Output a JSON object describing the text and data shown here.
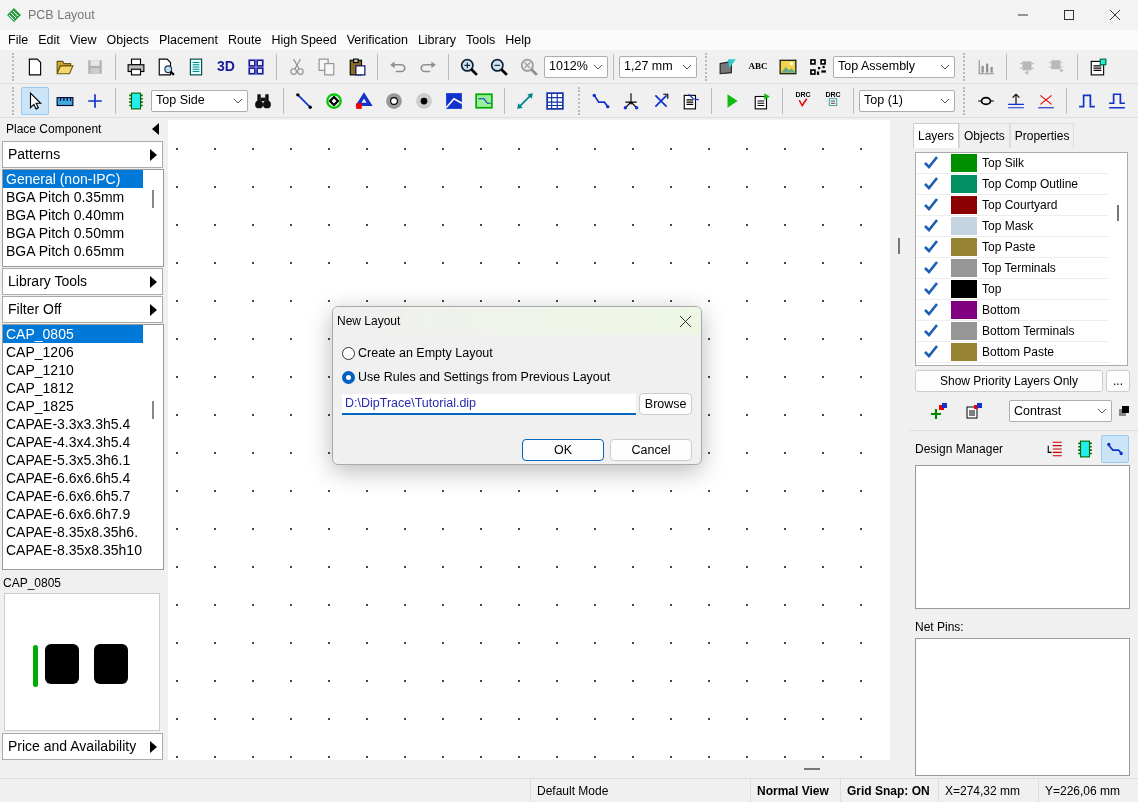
{
  "window": {
    "title": "PCB Layout"
  },
  "menu": [
    "File",
    "Edit",
    "View",
    "Objects",
    "Placement",
    "Route",
    "High Speed",
    "Verification",
    "Library",
    "Tools",
    "Help"
  ],
  "toolbars": [
    [
      {
        "kind": "grip"
      },
      {
        "kind": "button",
        "disabled": false,
        "pressed": false
      },
      {
        "kind": "button",
        "disabled": false,
        "pressed": false
      },
      {
        "kind": "button",
        "disabled": true,
        "pressed": false
      },
      {
        "kind": "sep"
      },
      {
        "kind": "button",
        "disabled": false,
        "pressed": false
      },
      {
        "kind": "button",
        "disabled": false,
        "pressed": false
      },
      {
        "kind": "button",
        "disabled": false,
        "pressed": false
      },
      {
        "kind": "label-button",
        "label": "3D",
        "disabled": false,
        "pressed": false
      },
      {
        "kind": "button",
        "disabled": false,
        "pressed": false
      },
      {
        "kind": "sep"
      },
      {
        "kind": "button",
        "disabled": true,
        "pressed": false
      },
      {
        "kind": "button",
        "disabled": true,
        "pressed": false
      },
      {
        "kind": "button",
        "disabled": false,
        "pressed": false
      },
      {
        "kind": "sep"
      },
      {
        "kind": "button",
        "disabled": true,
        "pressed": false
      },
      {
        "kind": "button",
        "disabled": true,
        "pressed": false
      },
      {
        "kind": "sep"
      },
      {
        "kind": "button",
        "disabled": false,
        "pressed": false
      },
      {
        "kind": "button",
        "disabled": false,
        "pressed": false
      },
      {
        "kind": "button",
        "disabled": true,
        "pressed": false
      },
      {
        "kind": "combo",
        "value": "1012%"
      },
      {
        "kind": "sep"
      },
      {
        "kind": "combo",
        "value": "1,27 mm"
      },
      {
        "kind": "grip"
      },
      {
        "kind": "button",
        "disabled": false,
        "pressed": false
      },
      {
        "kind": "label-button",
        "label": "ABC",
        "disabled": false,
        "pressed": false
      },
      {
        "kind": "button",
        "disabled": false,
        "pressed": false
      },
      {
        "kind": "button",
        "disabled": false,
        "pressed": false
      },
      {
        "kind": "combo",
        "value": "Top Assembly"
      },
      {
        "kind": "grip"
      },
      {
        "kind": "button",
        "disabled": true,
        "pressed": false
      },
      {
        "kind": "sep"
      },
      {
        "kind": "button",
        "disabled": true,
        "pressed": false
      },
      {
        "kind": "button",
        "disabled": true,
        "pressed": false
      },
      {
        "kind": "sep"
      },
      {
        "kind": "button",
        "disabled": false,
        "pressed": false
      }
    ],
    [
      {
        "kind": "grip"
      },
      {
        "kind": "button",
        "disabled": false,
        "pressed": true
      },
      {
        "kind": "button",
        "disabled": false,
        "pressed": false
      },
      {
        "kind": "button",
        "disabled": false,
        "pressed": false
      },
      {
        "kind": "sep"
      },
      {
        "kind": "button",
        "disabled": false,
        "pressed": false
      },
      {
        "kind": "combo",
        "value": "Top Side"
      },
      {
        "kind": "button",
        "disabled": false,
        "pressed": false
      },
      {
        "kind": "sep"
      },
      {
        "kind": "button",
        "disabled": false,
        "pressed": false
      },
      {
        "kind": "button",
        "disabled": false,
        "pressed": false
      },
      {
        "kind": "button",
        "disabled": false,
        "pressed": false
      },
      {
        "kind": "button",
        "disabled": false,
        "pressed": false
      },
      {
        "kind": "button",
        "disabled": false,
        "pressed": false
      },
      {
        "kind": "button",
        "disabled": false,
        "pressed": false
      },
      {
        "kind": "button",
        "disabled": false,
        "pressed": false
      },
      {
        "kind": "sep"
      },
      {
        "kind": "button",
        "disabled": false,
        "pressed": false
      },
      {
        "kind": "button",
        "disabled": false,
        "pressed": false
      },
      {
        "kind": "grip"
      },
      {
        "kind": "button",
        "disabled": false,
        "pressed": false
      },
      {
        "kind": "button",
        "disabled": false,
        "pressed": false
      },
      {
        "kind": "button",
        "disabled": false,
        "pressed": false
      },
      {
        "kind": "button",
        "disabled": false,
        "pressed": false
      },
      {
        "kind": "sep"
      },
      {
        "kind": "button",
        "disabled": false,
        "pressed": false
      },
      {
        "kind": "button",
        "disabled": false,
        "pressed": false
      },
      {
        "kind": "sep"
      },
      {
        "kind": "label-button",
        "label": "DRC",
        "disabled": false,
        "pressed": false
      },
      {
        "kind": "label-button",
        "label": "DRC",
        "disabled": false,
        "pressed": false
      },
      {
        "kind": "sep"
      },
      {
        "kind": "combo",
        "value": "Top (1)"
      },
      {
        "kind": "grip"
      },
      {
        "kind": "button",
        "disabled": false,
        "pressed": false
      },
      {
        "kind": "button",
        "disabled": false,
        "pressed": false
      },
      {
        "kind": "button",
        "disabled": false,
        "pressed": false
      },
      {
        "kind": "sep"
      },
      {
        "kind": "button",
        "disabled": false,
        "pressed": false
      },
      {
        "kind": "button",
        "disabled": false,
        "pressed": false
      }
    ]
  ],
  "left_panel": {
    "title": "Place Component",
    "patterns_button": "Patterns",
    "pattern_groups": [
      {
        "label": "General (non-IPC)",
        "selected": true
      },
      {
        "label": "BGA Pitch 0.35mm",
        "selected": false
      },
      {
        "label": "BGA Pitch 0.40mm",
        "selected": false
      },
      {
        "label": "BGA Pitch 0.50mm",
        "selected": false
      },
      {
        "label": "BGA Pitch 0.65mm",
        "selected": false
      }
    ],
    "library_tools_button": "Library Tools",
    "filter_button": "Filter Off",
    "patterns": [
      {
        "label": "CAP_0805",
        "selected": true
      },
      {
        "label": "CAP_1206",
        "selected": false
      },
      {
        "label": "CAP_1210",
        "selected": false
      },
      {
        "label": "CAP_1812",
        "selected": false
      },
      {
        "label": "CAP_1825",
        "selected": false
      },
      {
        "label": "CAPAE-3.3x3.3h5.4",
        "selected": false
      },
      {
        "label": "CAPAE-4.3x4.3h5.4",
        "selected": false
      },
      {
        "label": "CAPAE-5.3x5.3h6.1",
        "selected": false
      },
      {
        "label": "CAPAE-6.6x6.6h5.4",
        "selected": false
      },
      {
        "label": "CAPAE-6.6x6.6h5.7",
        "selected": false
      },
      {
        "label": "CAPAE-6.6x6.6h7.9",
        "selected": false
      },
      {
        "label": "CAPAE-8.35x8.35h6.",
        "selected": false
      },
      {
        "label": "CAPAE-8.35x8.35h10",
        "selected": false
      }
    ],
    "preview_title": "CAP_0805",
    "price_button": "Price and Availability"
  },
  "dialog": {
    "title": "New Layout",
    "options": [
      {
        "label": "Create an Empty Layout",
        "selected": false
      },
      {
        "label": "Use Rules and Settings from Previous Layout",
        "selected": true
      }
    ],
    "path": "D:\\DipTrace\\Tutorial.dip",
    "browse_button": "Browse",
    "ok_button": "OK",
    "cancel_button": "Cancel"
  },
  "right_panel": {
    "tabs": [
      {
        "label": "Layers",
        "selected": true
      },
      {
        "label": "Objects",
        "selected": false
      },
      {
        "label": "Properties",
        "selected": false
      }
    ],
    "layers": [
      {
        "name": "Top Silk",
        "color": "#008f00",
        "visible": true
      },
      {
        "name": "Top Comp Outline",
        "color": "#009062",
        "visible": true
      },
      {
        "name": "Top Courtyard",
        "color": "#8b0000",
        "visible": true
      },
      {
        "name": "Top Mask",
        "color": "#c4d5e1",
        "visible": true
      },
      {
        "name": "Top Paste",
        "color": "#978432",
        "visible": true
      },
      {
        "name": "Top Terminals",
        "color": "#969696",
        "visible": true
      },
      {
        "name": "Top",
        "color": "#000000",
        "visible": true
      },
      {
        "name": "Bottom",
        "color": "#800080",
        "visible": true
      },
      {
        "name": "Bottom Terminals",
        "color": "#969696",
        "visible": true
      },
      {
        "name": "Bottom Paste",
        "color": "#978432",
        "visible": true
      }
    ],
    "priority_button": "Show Priority Layers Only",
    "more_button": "...",
    "mode_combo": "Contrast",
    "design_manager": {
      "title": "Design Manager",
      "tools": [
        {
          "selected": false
        },
        {
          "selected": false
        },
        {
          "selected": true
        }
      ]
    },
    "net_pins_label": "Net Pins:"
  },
  "status_bar": [
    {
      "text": "Default Mode",
      "bold": false
    },
    {
      "text": "Normal View",
      "bold": true
    },
    {
      "text": "Grid Snap: ON",
      "bold": true
    },
    {
      "text": "X=274,32 mm",
      "bold": false
    },
    {
      "text": "Y=226,06 mm",
      "bold": false
    }
  ]
}
